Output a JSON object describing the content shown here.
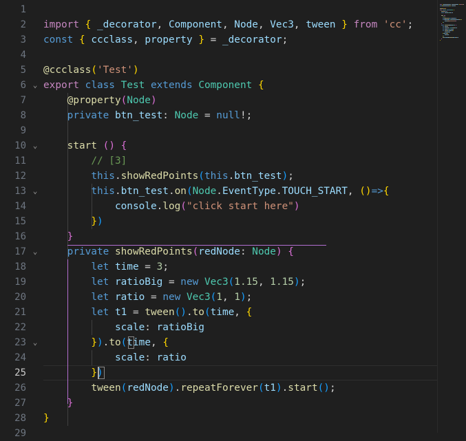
{
  "editor": {
    "language": "typescript",
    "active_line": 25,
    "colors": {
      "background": "#1f1f1f",
      "line_number": "#6e7681",
      "line_number_active": "#cccccc",
      "keyword_control": "#c586c0",
      "keyword": "#569cd6",
      "type": "#4ec9b0",
      "function": "#dcdcaa",
      "variable": "#9cdcfe",
      "string": "#ce9178",
      "number": "#b5cea8",
      "comment": "#6a9955",
      "bracket_level_1": "#ffd700",
      "bracket_level_2": "#da70d6",
      "bracket_level_3": "#179fff"
    },
    "fold_icon": "chevron-down-icon",
    "line_numbers": [
      "1",
      "2",
      "3",
      "4",
      "5",
      "6",
      "7",
      "8",
      "9",
      "10",
      "11",
      "12",
      "13",
      "14",
      "15",
      "16",
      "17",
      "18",
      "19",
      "20",
      "21",
      "22",
      "23",
      "24",
      "25",
      "26",
      "27",
      "28",
      "29"
    ],
    "folds": {
      "6": "⌄",
      "10": "⌄",
      "13": "⌄",
      "17": "⌄",
      "23": "⌄"
    },
    "lines": [
      [],
      [
        [
          "kw",
          "import"
        ],
        [
          "tx",
          " "
        ],
        [
          "b1",
          "{"
        ],
        [
          "tx",
          " "
        ],
        [
          "va",
          "_decorator"
        ],
        [
          "tx",
          ", "
        ],
        [
          "va",
          "Component"
        ],
        [
          "tx",
          ", "
        ],
        [
          "va",
          "Node"
        ],
        [
          "tx",
          ", "
        ],
        [
          "va",
          "Vec3"
        ],
        [
          "tx",
          ", "
        ],
        [
          "va",
          "tween"
        ],
        [
          "tx",
          " "
        ],
        [
          "b1",
          "}"
        ],
        [
          "tx",
          " "
        ],
        [
          "kw",
          "from"
        ],
        [
          "tx",
          " "
        ],
        [
          "st",
          "'cc'"
        ],
        [
          "tx",
          ";"
        ]
      ],
      [
        [
          "kb",
          "const"
        ],
        [
          "tx",
          " "
        ],
        [
          "b1",
          "{"
        ],
        [
          "tx",
          " "
        ],
        [
          "va",
          "ccclass"
        ],
        [
          "tx",
          ", "
        ],
        [
          "va",
          "property"
        ],
        [
          "tx",
          " "
        ],
        [
          "b1",
          "}"
        ],
        [
          "tx",
          " = "
        ],
        [
          "va",
          "_decorator"
        ],
        [
          "tx",
          ";"
        ]
      ],
      [],
      [
        [
          "fn",
          "@ccclass"
        ],
        [
          "b1",
          "("
        ],
        [
          "st",
          "'Test'"
        ],
        [
          "b1",
          ")"
        ]
      ],
      [
        [
          "kw",
          "export"
        ],
        [
          "tx",
          " "
        ],
        [
          "kb",
          "class"
        ],
        [
          "tx",
          " "
        ],
        [
          "ty",
          "Test"
        ],
        [
          "tx",
          " "
        ],
        [
          "kb",
          "extends"
        ],
        [
          "tx",
          " "
        ],
        [
          "ty",
          "Component"
        ],
        [
          "tx",
          " "
        ],
        [
          "b1",
          "{"
        ]
      ],
      [
        [
          "tx",
          "    "
        ],
        [
          "fn",
          "@property"
        ],
        [
          "b2",
          "("
        ],
        [
          "ty",
          "Node"
        ],
        [
          "b2",
          ")"
        ]
      ],
      [
        [
          "tx",
          "    "
        ],
        [
          "kb",
          "private"
        ],
        [
          "tx",
          " "
        ],
        [
          "va",
          "btn_test"
        ],
        [
          "tx",
          ": "
        ],
        [
          "ty",
          "Node"
        ],
        [
          "tx",
          " = "
        ],
        [
          "kb",
          "null"
        ],
        [
          "tx",
          "!;"
        ]
      ],
      [],
      [
        [
          "tx",
          "    "
        ],
        [
          "fn",
          "start"
        ],
        [
          "tx",
          " "
        ],
        [
          "b2",
          "()"
        ],
        [
          "tx",
          " "
        ],
        [
          "b2",
          "{"
        ]
      ],
      [
        [
          "tx",
          "        "
        ],
        [
          "cm",
          "// [3]"
        ]
      ],
      [
        [
          "tx",
          "        "
        ],
        [
          "kb",
          "this"
        ],
        [
          "tx",
          "."
        ],
        [
          "fn",
          "showRedPoints"
        ],
        [
          "b3",
          "("
        ],
        [
          "kb",
          "this"
        ],
        [
          "tx",
          "."
        ],
        [
          "va",
          "btn_test"
        ],
        [
          "b3",
          ")"
        ],
        [
          "tx",
          ";"
        ]
      ],
      [
        [
          "tx",
          "        "
        ],
        [
          "kb",
          "this"
        ],
        [
          "tx",
          "."
        ],
        [
          "va",
          "btn_test"
        ],
        [
          "tx",
          "."
        ],
        [
          "fn",
          "on"
        ],
        [
          "b3",
          "("
        ],
        [
          "ty",
          "Node"
        ],
        [
          "tx",
          "."
        ],
        [
          "va",
          "EventType"
        ],
        [
          "tx",
          "."
        ],
        [
          "va",
          "TOUCH_START"
        ],
        [
          "tx",
          ", "
        ],
        [
          "b1",
          "()"
        ],
        [
          "kb",
          "=>"
        ],
        [
          "b1",
          "{"
        ]
      ],
      [
        [
          "tx",
          "            "
        ],
        [
          "va",
          "console"
        ],
        [
          "tx",
          "."
        ],
        [
          "fn",
          "log"
        ],
        [
          "b2",
          "("
        ],
        [
          "st",
          "\"click start here\""
        ],
        [
          "b2",
          ")"
        ]
      ],
      [
        [
          "tx",
          "        "
        ],
        [
          "b1",
          "}"
        ],
        [
          "b3",
          ")"
        ]
      ],
      [
        [
          "tx",
          "    "
        ],
        [
          "b2",
          "}"
        ]
      ],
      [
        [
          "tx",
          "    "
        ],
        [
          "kb",
          "private"
        ],
        [
          "tx",
          " "
        ],
        [
          "fn",
          "showRedPoints"
        ],
        [
          "b2",
          "("
        ],
        [
          "va",
          "redNode"
        ],
        [
          "tx",
          ": "
        ],
        [
          "ty",
          "Node"
        ],
        [
          "b2",
          ")"
        ],
        [
          "tx",
          " "
        ],
        [
          "b2",
          "{"
        ]
      ],
      [
        [
          "tx",
          "        "
        ],
        [
          "kb",
          "let"
        ],
        [
          "tx",
          " "
        ],
        [
          "va",
          "time"
        ],
        [
          "tx",
          " = "
        ],
        [
          "nu",
          "3"
        ],
        [
          "tx",
          ";"
        ]
      ],
      [
        [
          "tx",
          "        "
        ],
        [
          "kb",
          "let"
        ],
        [
          "tx",
          " "
        ],
        [
          "va",
          "ratioBig"
        ],
        [
          "tx",
          " = "
        ],
        [
          "kb",
          "new"
        ],
        [
          "tx",
          " "
        ],
        [
          "ty",
          "Vec3"
        ],
        [
          "b3",
          "("
        ],
        [
          "nu",
          "1.15"
        ],
        [
          "tx",
          ", "
        ],
        [
          "nu",
          "1.15"
        ],
        [
          "b3",
          ")"
        ],
        [
          "tx",
          ";"
        ]
      ],
      [
        [
          "tx",
          "        "
        ],
        [
          "kb",
          "let"
        ],
        [
          "tx",
          " "
        ],
        [
          "va",
          "ratio"
        ],
        [
          "tx",
          " = "
        ],
        [
          "kb",
          "new"
        ],
        [
          "tx",
          " "
        ],
        [
          "ty",
          "Vec3"
        ],
        [
          "b3",
          "("
        ],
        [
          "nu",
          "1"
        ],
        [
          "tx",
          ", "
        ],
        [
          "nu",
          "1"
        ],
        [
          "b3",
          ")"
        ],
        [
          "tx",
          ";"
        ]
      ],
      [
        [
          "tx",
          "        "
        ],
        [
          "kb",
          "let"
        ],
        [
          "tx",
          " "
        ],
        [
          "va",
          "t1"
        ],
        [
          "tx",
          " = "
        ],
        [
          "fn",
          "tween"
        ],
        [
          "b3",
          "()"
        ],
        [
          "tx",
          "."
        ],
        [
          "fn",
          "to"
        ],
        [
          "b3",
          "("
        ],
        [
          "va",
          "time"
        ],
        [
          "tx",
          ", "
        ],
        [
          "b1",
          "{"
        ]
      ],
      [
        [
          "tx",
          "            "
        ],
        [
          "va",
          "scale"
        ],
        [
          "tx",
          ": "
        ],
        [
          "va",
          "ratioBig"
        ]
      ],
      [
        [
          "tx",
          "        "
        ],
        [
          "b1",
          "}"
        ],
        [
          "b3",
          ")"
        ],
        [
          "tx",
          "."
        ],
        [
          "fn",
          "to"
        ],
        [
          "b3",
          "("
        ],
        [
          "va",
          "time"
        ],
        [
          "tx",
          ", "
        ],
        [
          "b1",
          "{"
        ]
      ],
      [
        [
          "tx",
          "            "
        ],
        [
          "va",
          "scale"
        ],
        [
          "tx",
          ": "
        ],
        [
          "va",
          "ratio"
        ]
      ],
      [
        [
          "tx",
          "        "
        ],
        [
          "b1",
          "}"
        ],
        [
          "b3",
          ")"
        ]
      ],
      [
        [
          "tx",
          "        "
        ],
        [
          "fn",
          "tween"
        ],
        [
          "b3",
          "("
        ],
        [
          "va",
          "redNode"
        ],
        [
          "b3",
          ")"
        ],
        [
          "tx",
          "."
        ],
        [
          "fn",
          "repeatForever"
        ],
        [
          "b3",
          "("
        ],
        [
          "va",
          "t1"
        ],
        [
          "b3",
          ")"
        ],
        [
          "tx",
          "."
        ],
        [
          "fn",
          "start"
        ],
        [
          "b3",
          "()"
        ],
        [
          "tx",
          ";"
        ]
      ],
      [
        [
          "tx",
          "    "
        ],
        [
          "b2",
          "}"
        ]
      ],
      [
        [
          "b1",
          "}"
        ]
      ],
      []
    ]
  }
}
